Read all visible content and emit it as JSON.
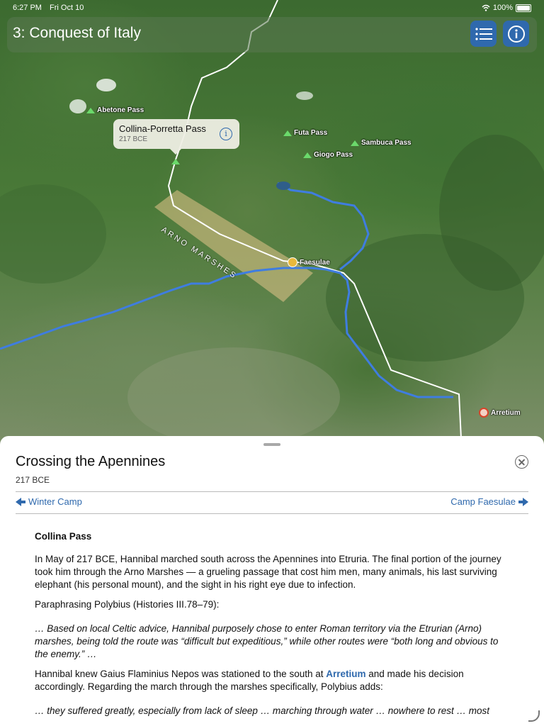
{
  "status_bar": {
    "time": "6:27 PM",
    "date": "Fri Oct 10",
    "battery": "100%"
  },
  "header": {
    "title": "3: Conquest of Italy",
    "list_icon": "list-icon",
    "info_icon": "info-icon"
  },
  "map": {
    "passes": [
      {
        "name": "Abetone Pass"
      },
      {
        "name": "Futa Pass"
      },
      {
        "name": "Sambuca Pass"
      },
      {
        "name": "Giogo Pass"
      }
    ],
    "callout": {
      "title": "Collina-Porretta Pass",
      "subtitle": "217 BCE"
    },
    "region_label": "ARNO MARSHES",
    "cities": [
      {
        "name": "Faesulae"
      },
      {
        "name": "Arretium"
      }
    ],
    "colors": {
      "river": "#3f7de0",
      "route": "#ffffff",
      "marsh": "#e3c48a",
      "accent": "#2f69ad"
    }
  },
  "sheet": {
    "title": "Crossing the Apennines",
    "date": "217 BCE",
    "prev_label": "Winter Camp",
    "next_label": "Camp Faesulae",
    "subheading": "Collina Pass",
    "p1": "In May of 217 BCE, Hannibal marched south across the Apennines into Etruria. The final portion of the journey took him through the Arno Marshes — a grueling passage that cost him men, many animals, his last surviving elephant (his personal mount), and the sight in his right eye due to infection.",
    "p2": "Paraphrasing Polybius (Histories III.78–79):",
    "q1": "… Based on local Celtic advice, Hannibal purposely chose to enter Roman territory via the Etrurian (Arno) marshes, being told the route was “difficult but expeditious,” while other routes were “both long and obvious to the enemy.” …",
    "p3_before": "Hannibal knew Gaius Flaminius Nepos was stationed to the south at ",
    "p3_link": "Arretium",
    "p3_after": " and made his decision accordingly. Regarding the march through the marshes specifically, Polybius adds:",
    "q2": "… they suffered greatly, especially from lack of sleep … marching through water … nowhere to rest … most"
  }
}
